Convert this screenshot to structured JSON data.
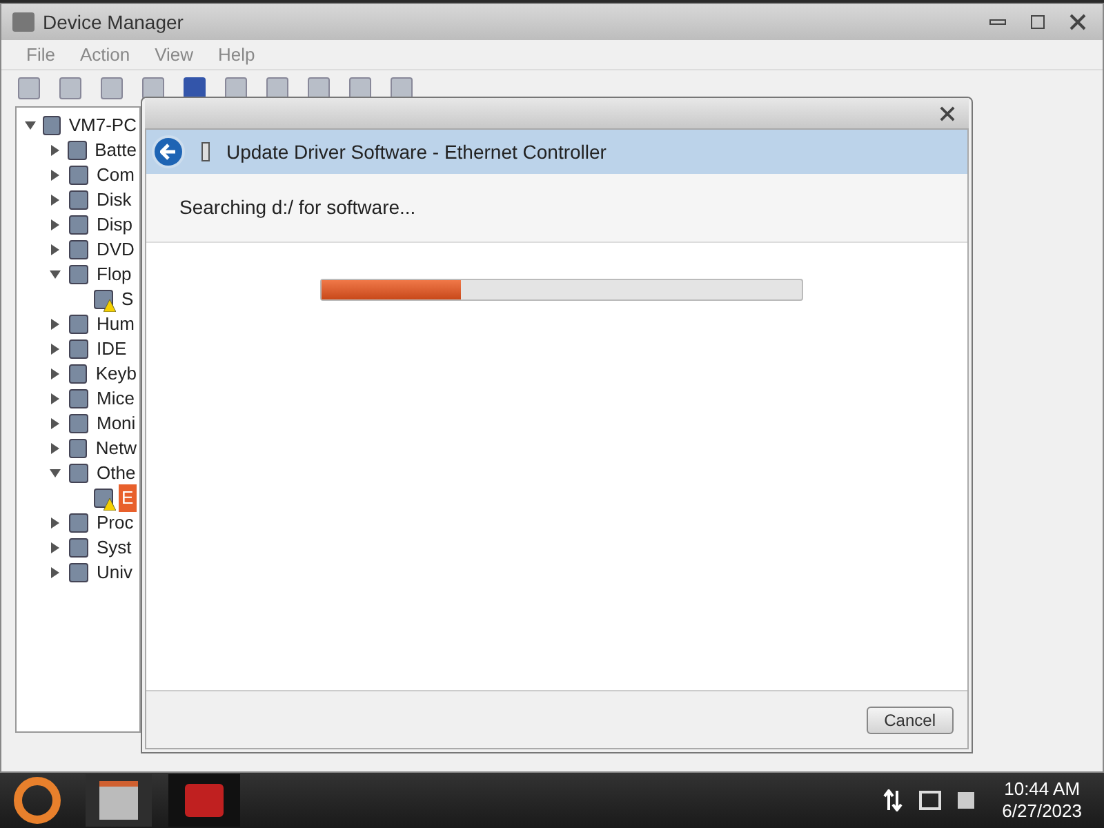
{
  "window": {
    "title": "Device Manager"
  },
  "menu": [
    "File",
    "Action",
    "View",
    "Help"
  ],
  "tree": [
    {
      "label": "VM7-PC",
      "expanded": true,
      "selected": false,
      "children": [
        {
          "label": "Batte",
          "expanded": false,
          "selected": false
        },
        {
          "label": "Com",
          "expanded": false,
          "selected": false
        },
        {
          "label": "Disk",
          "expanded": false,
          "selected": false
        },
        {
          "label": "Disp",
          "expanded": false,
          "selected": false
        },
        {
          "label": "DVD",
          "expanded": false,
          "selected": false
        },
        {
          "label": "Flop",
          "expanded": true,
          "selected": false,
          "children": [
            {
              "label": "S",
              "warning": true,
              "selected": false
            }
          ]
        },
        {
          "label": "Hum",
          "expanded": false,
          "selected": false
        },
        {
          "label": "IDE",
          "expanded": false,
          "selected": false
        },
        {
          "label": "Keyb",
          "expanded": false,
          "selected": false
        },
        {
          "label": "Mice",
          "expanded": false,
          "selected": false
        },
        {
          "label": "Moni",
          "expanded": false,
          "selected": false
        },
        {
          "label": "Netw",
          "expanded": false,
          "selected": false
        },
        {
          "label": "Othe",
          "expanded": true,
          "selected": false,
          "children": [
            {
              "label": "E",
              "warning": true,
              "selected": true
            }
          ]
        },
        {
          "label": "Proc",
          "expanded": false,
          "selected": false
        },
        {
          "label": "Syst",
          "expanded": false,
          "selected": false
        },
        {
          "label": "Univ",
          "expanded": false,
          "selected": false
        }
      ]
    }
  ],
  "dialog": {
    "title": "Update Driver Software - Ethernet Controller",
    "status": "Searching d:/ for software...",
    "progress": {
      "level": 0.29
    },
    "buttons": [
      "Cancel"
    ]
  },
  "taskbar": {
    "time": "10:44 AM",
    "date": "6/27/2023"
  }
}
